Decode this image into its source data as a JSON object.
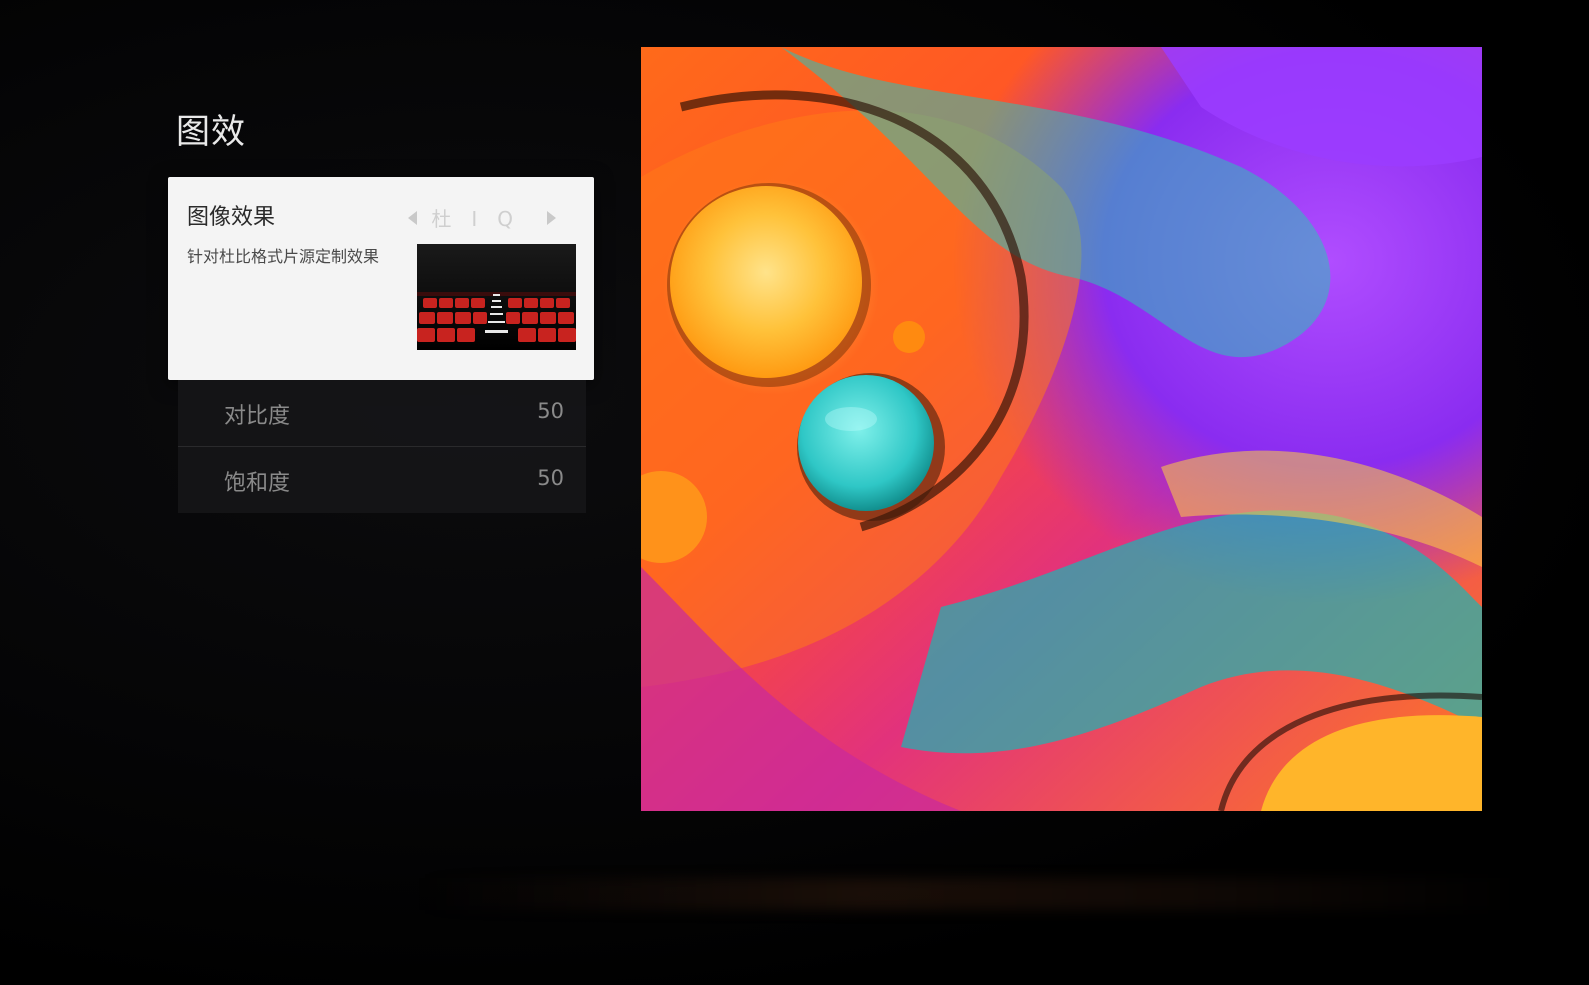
{
  "panel": {
    "title": "图效"
  },
  "picture_effect": {
    "label": "图像效果",
    "selected_value": "杜IQ",
    "description": "针对杜比格式片源定制效果",
    "thumbnail_icon": "cinema-seats-thumbnail"
  },
  "settings": [
    {
      "label": "对比度",
      "value": "50"
    },
    {
      "label": "饱和度",
      "value": "50"
    }
  ],
  "colors": {
    "card_bg": "#f4f4f4",
    "row_bg": "#161618",
    "screen_bg": "#000000"
  }
}
